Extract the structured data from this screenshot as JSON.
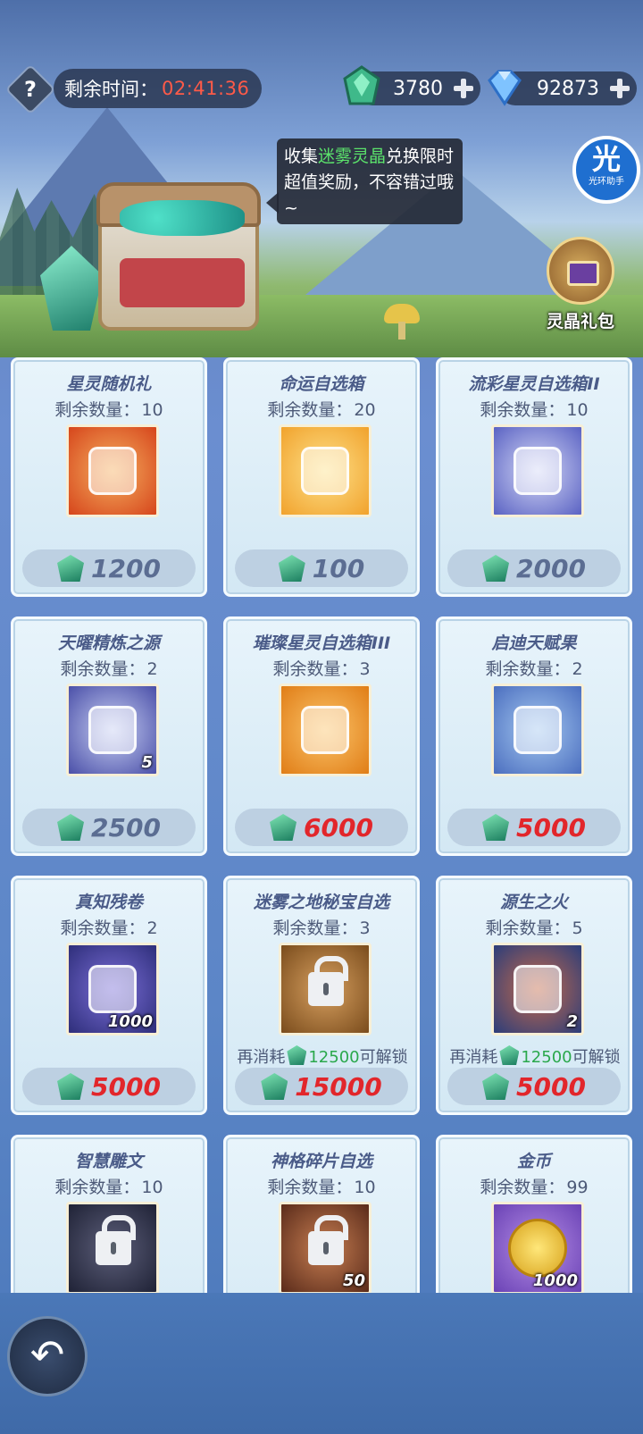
{
  "header": {
    "timer_label": "剩余时间：",
    "timer_value": "02:41:36",
    "currency_crystal": "3780",
    "currency_diamond": "92873",
    "tooltip_prefix": "收集",
    "tooltip_highlight": "迷雾灵晶",
    "tooltip_rest": "兑换限时超值奖励，不容错过哦~",
    "assist_big": "光",
    "assist_small": "光环助手",
    "giftpack_label": "灵晶礼包"
  },
  "stock_label": "剩余数量：",
  "unlock_prefix": "再消耗",
  "unlock_suffix": "可解锁",
  "items": [
    {
      "name": "星灵随机礼",
      "stock": "10",
      "price": "1200",
      "price_color": "gray",
      "art": "red"
    },
    {
      "name": "命运自选箱",
      "stock": "20",
      "price": "100",
      "price_color": "gray",
      "art": "gold"
    },
    {
      "name": "流彩星灵自选箱II",
      "stock": "10",
      "price": "2000",
      "price_color": "gray",
      "art": "blue"
    },
    {
      "name": "天曜精炼之源",
      "stock": "2",
      "price": "2500",
      "price_color": "gray",
      "art": "cyl",
      "qty": "5"
    },
    {
      "name": "璀璨星灵自选箱III",
      "stock": "3",
      "price": "6000",
      "price_color": "red",
      "art": "orange"
    },
    {
      "name": "启迪天赋果",
      "stock": "2",
      "price": "5000",
      "price_color": "red",
      "art": "veg"
    },
    {
      "name": "真知残卷",
      "stock": "2",
      "price": "5000",
      "price_color": "red",
      "art": "scroll",
      "qty": "1000"
    },
    {
      "name": "迷雾之地秘宝自选",
      "stock": "3",
      "price": "15000",
      "price_color": "red",
      "art": "bronze",
      "locked": true,
      "unlock_amount": "12500"
    },
    {
      "name": "源生之火",
      "stock": "5",
      "price": "5000",
      "price_color": "red",
      "art": "fire",
      "qty": "2",
      "unlock_amount": "12500"
    },
    {
      "name": "智慧雕文",
      "stock": "10",
      "art": "dark",
      "locked": true
    },
    {
      "name": "神格碎片自选",
      "stock": "10",
      "art": "brown",
      "locked": true,
      "qty": "50"
    },
    {
      "name": "金币",
      "stock": "99",
      "art": "purple",
      "qty": "1000"
    }
  ],
  "colors": {
    "price_red": "#e2262b",
    "timer_red": "#ff5a48",
    "highlight_green": "#5be26b",
    "unlock_green": "#2aa84c"
  },
  "icons": {
    "help": "question-icon",
    "crystal": "crystal-gem-icon",
    "diamond": "diamond-icon",
    "plus": "plus-icon",
    "back": "back-arrow-icon"
  }
}
